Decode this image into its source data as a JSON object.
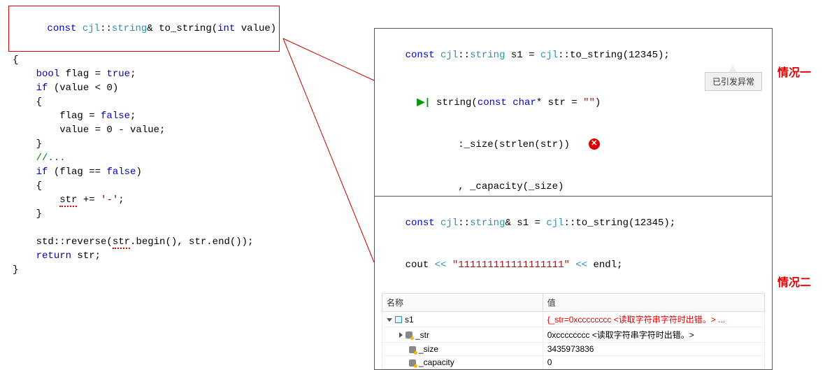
{
  "left_code": {
    "sig_const": "const",
    "sig_ns": "cjl",
    "sig_type": "string",
    "sig_amp": "&",
    "sig_fn": "to_string",
    "sig_param_t": "int",
    "sig_param_n": "value",
    "l_openbrace": "{",
    "l_bool": "bool",
    "l_flag": "flag",
    "l_eq": "=",
    "l_true": "true",
    "l_if": "if",
    "l_cond1": "(value < 0)",
    "l_flag_false": "flag = ",
    "l_false": "false",
    "l_val_neg": "value = 0 - value;",
    "l_comment": "//...",
    "l_cond2": "(flag == ",
    "l_false2": "false",
    "l_str": "str",
    "l_pluseq": " += ",
    "l_dash": "'-'",
    "l_semi": ";",
    "l_rev_prefix": "std::reverse(",
    "l_str2": "str",
    "l_rev_mid": ".begin(), str.end());",
    "l_return": "return",
    "l_ret_str": " str;",
    "l_closebrace": "}"
  },
  "panel1": {
    "line1_const": "const",
    "line1_ns": "cjl",
    "line1_type": "string",
    "line1_var": "s1",
    "line1_eq": "=",
    "line1_call_ns": "cjl",
    "line1_call_fn": "to_string",
    "line1_arg": "12345",
    "line2_fn": "string",
    "line2_open": "(",
    "line2_const": "const",
    "line2_char": "char",
    "line2_ptr": "*",
    "line2_param": "str",
    "line2_eq": "=",
    "line2_default": "\"\"",
    "line2_close": ")",
    "line3": ":_size(strlen(str))",
    "line4": ", _capacity(_size)",
    "tooltip": "已引发异常"
  },
  "panel2": {
    "line1_const": "const",
    "line1_ns": "cjl",
    "line1_type": "string",
    "line1_amp": "&",
    "line1_var": "s1",
    "line1_eq": "=",
    "line1_call_ns": "cjl",
    "line1_call_fn": "to_string",
    "line1_arg": "12345",
    "line2_cout": "cout",
    "line2_op1": "<<",
    "line2_str": "\"111111111111111111\"",
    "line2_op2": "<<",
    "line2_endl": "endl",
    "th_name": "名称",
    "th_val": "值",
    "row0_name": "s1",
    "row0_val": "{_str=0xcccccccc <读取字符串字符时出错。> ...",
    "row1_name": "_str",
    "row1_val": "0xcccccccc <读取字符串字符时出错。>",
    "row2_name": "_size",
    "row2_val": "3435973836",
    "row3_name": "_capacity",
    "row3_val": "0"
  },
  "labels": {
    "case1": "情况一",
    "case2": "情况二"
  }
}
